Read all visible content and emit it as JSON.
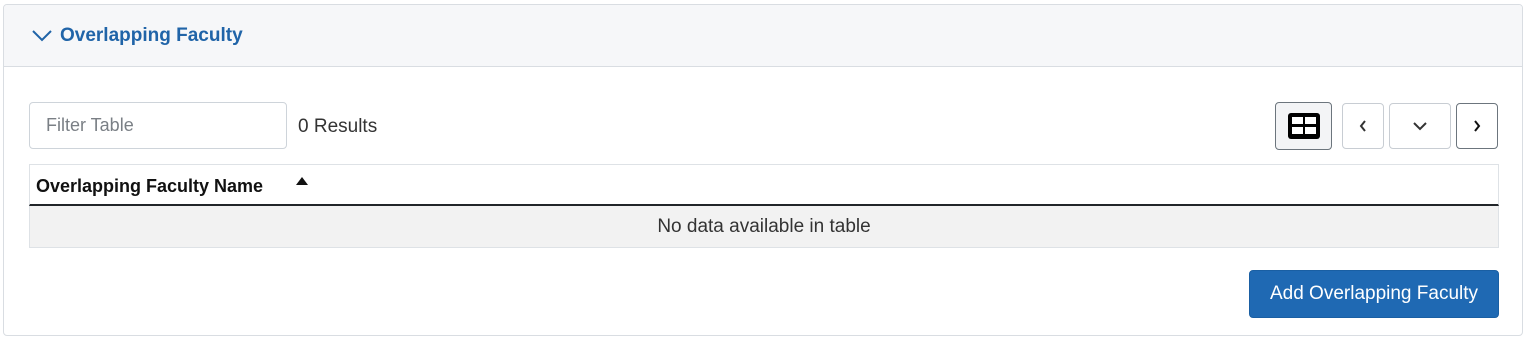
{
  "section": {
    "title": "Overlapping Faculty",
    "toggle_icon": "chevron-down-icon"
  },
  "filter": {
    "placeholder": "Filter Table",
    "value": ""
  },
  "results": {
    "count_label": "0 Results"
  },
  "toolbar": {
    "grid_icon": "table-layout-icon",
    "prev_icon": "chevron-left-icon",
    "page_dropdown_icon": "chevron-down-icon",
    "next_icon": "chevron-right-icon"
  },
  "table": {
    "columns": [
      {
        "label": "Overlapping Faculty Name",
        "sort": "ascending",
        "sort_icon": "sort-up-icon"
      }
    ],
    "rows": [],
    "empty_message": "No data available in table"
  },
  "actions": {
    "add_label": "Add Overlapping Faculty"
  },
  "colors": {
    "accent": "#1f69b3",
    "header_text": "#2064a8",
    "header_bg": "#f6f7f9",
    "empty_row_bg": "#f2f2f2"
  }
}
